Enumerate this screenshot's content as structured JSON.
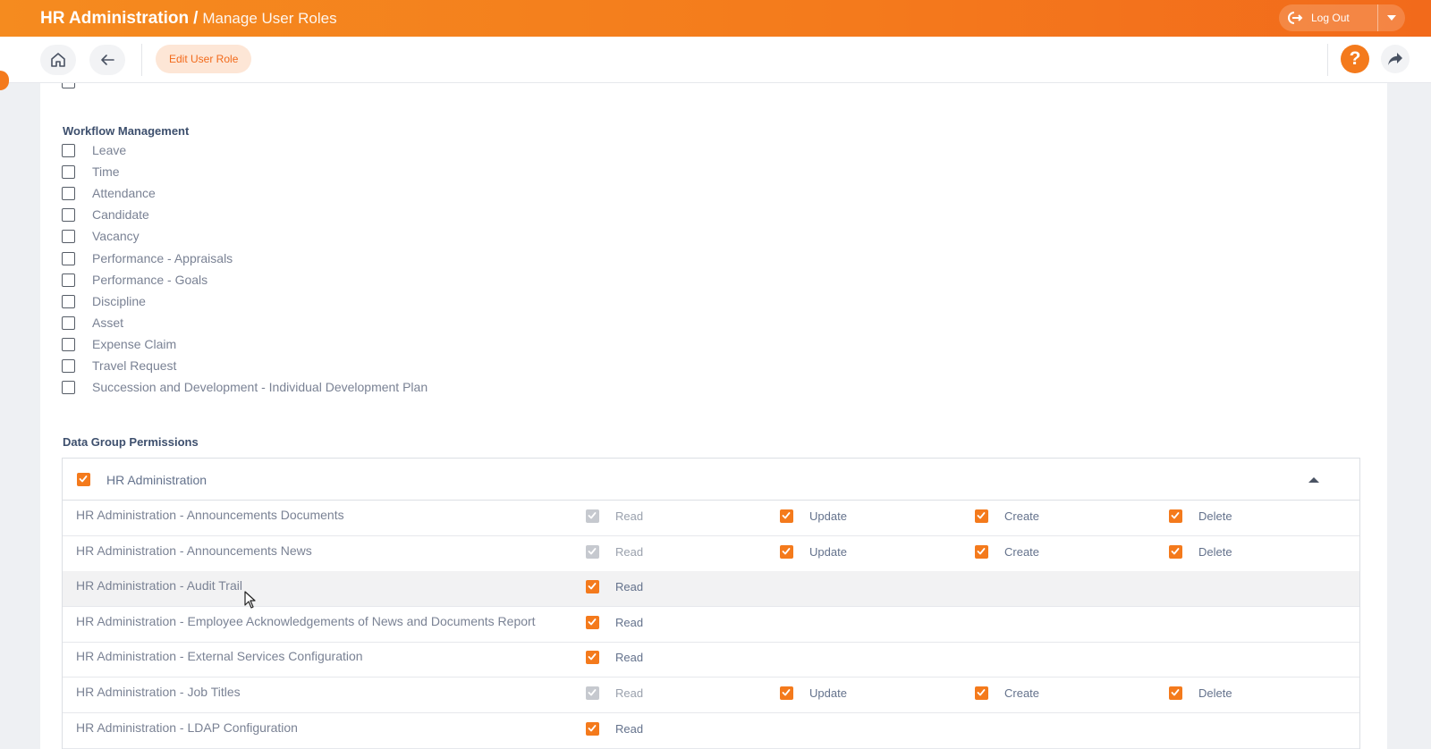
{
  "header": {
    "title": "HR Administration",
    "separator": "/",
    "subtitle": "Manage User Roles",
    "logout_label": "Log Out"
  },
  "toolbar": {
    "edit_chip": "Edit User Role",
    "help_label": "?"
  },
  "workflow": {
    "title": "Workflow Management",
    "items": [
      {
        "label": "Leave",
        "checked": false
      },
      {
        "label": "Time",
        "checked": false
      },
      {
        "label": "Attendance",
        "checked": false
      },
      {
        "label": "Candidate",
        "checked": false
      },
      {
        "label": "Vacancy",
        "checked": false
      },
      {
        "label": "Performance - Appraisals",
        "checked": false
      },
      {
        "label": "Performance - Goals",
        "checked": false
      },
      {
        "label": "Discipline",
        "checked": false
      },
      {
        "label": "Asset",
        "checked": false
      },
      {
        "label": "Expense Claim",
        "checked": false
      },
      {
        "label": "Travel Request",
        "checked": false
      },
      {
        "label": "Succession and Development - Individual Development Plan",
        "checked": false
      }
    ]
  },
  "data_group": {
    "title": "Data Group Permissions",
    "group_label": "HR Administration",
    "group_checked": true,
    "perm_labels": {
      "read": "Read",
      "update": "Update",
      "create": "Create",
      "delete": "Delete"
    },
    "rows": [
      {
        "name": "HR Administration - Announcements Documents",
        "read": "disabled",
        "update": true,
        "create": true,
        "delete": true
      },
      {
        "name": "HR Administration - Announcements News",
        "read": "disabled",
        "update": true,
        "create": true,
        "delete": true
      },
      {
        "name": "HR Administration - Audit Trail",
        "read": true,
        "highlighted": true
      },
      {
        "name": "HR Administration - Employee Acknowledgements of News and Documents Report",
        "read": true
      },
      {
        "name": "HR Administration - External Services Configuration",
        "read": true
      },
      {
        "name": "HR Administration - Job Titles",
        "read": "disabled",
        "update": true,
        "create": true,
        "delete": true
      },
      {
        "name": "HR Administration - LDAP Configuration",
        "read": true
      }
    ]
  },
  "colors": {
    "accent": "#f47a1c",
    "header_gradient_start": "#f58b1f",
    "header_gradient_end": "#f26a1b",
    "disabled_check": "#c6c9cf"
  }
}
